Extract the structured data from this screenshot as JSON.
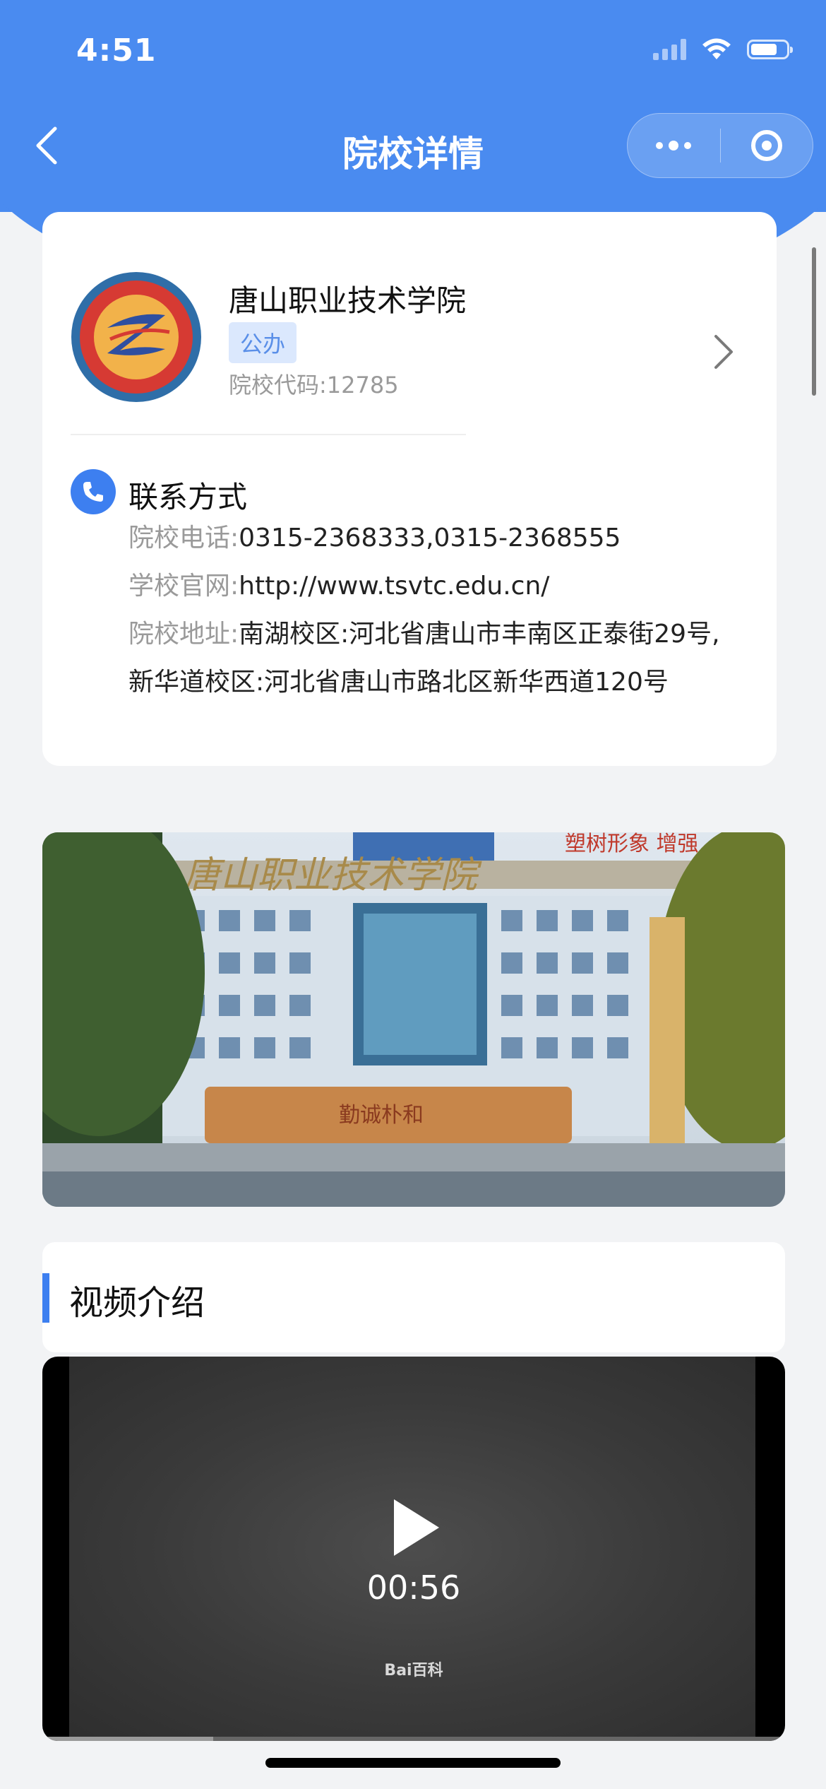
{
  "status_bar": {
    "time": "4:51"
  },
  "nav": {
    "title": "院校详情"
  },
  "school": {
    "name": "唐山职业技术学院",
    "type_tag": "公办",
    "code_label": "院校代码:",
    "code_value": "12785",
    "logo_motto": "勤诚朴和"
  },
  "contact": {
    "title": "联系方式",
    "phone_label": "院校电话:",
    "phone_value": "0315-2368333,0315-2368555",
    "website_label": "学校官网:",
    "website_value": "http://www.tsvtc.edu.cn/",
    "address_label": "院校地址:",
    "address_value": "南湖校区:河北省唐山市丰南区正泰街29号,新华道校区:河北省唐山市路北区新华西道120号"
  },
  "campus_photo": {
    "gate_text": "唐山职业技术学院",
    "banner_text": "塑树形象 增强",
    "rock_text": "勤诚朴和"
  },
  "video": {
    "section_title": "视频介绍",
    "duration": "00:56",
    "watermark": "Bai百科",
    "progress_fraction": 0.23
  },
  "colors": {
    "brand_blue": "#4a8bf0",
    "accent_blue": "#3d7ff0",
    "tag_bg": "#dbe8fd"
  }
}
